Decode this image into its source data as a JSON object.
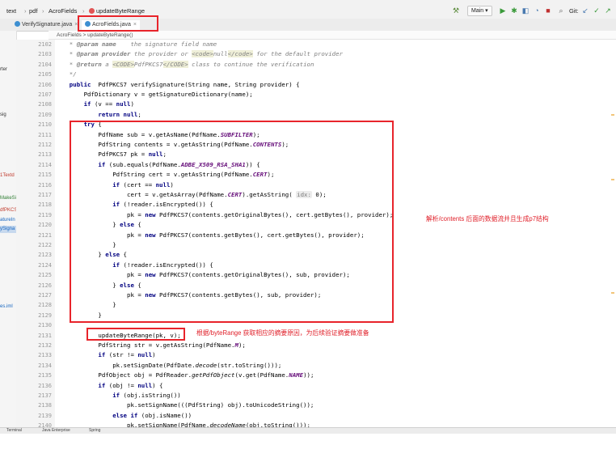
{
  "navbar": {
    "breadcrumbs": [
      "text",
      "pdf",
      "AcroFields",
      "updateByteRange"
    ],
    "branch": "Main",
    "git_label": "Git:"
  },
  "tabs": [
    {
      "label": "VerifySignature.java",
      "active": false
    },
    {
      "label": "AcroFields.java",
      "active": true
    }
  ],
  "editor_breadcrumb": "AcroFields  >  updateByteRange()",
  "sidebar": {
    "items": [
      "rter",
      "sig",
      "1Textd",
      "MakeSi",
      "dfPKCS",
      "atureIn",
      "ySigna",
      "es.iml"
    ]
  },
  "code": {
    "lines": [
      {
        "n": "2102",
        "segs": [
          [
            "cm",
            "    * "
          ],
          [
            "tg",
            "@param"
          ],
          [
            "cm",
            " "
          ],
          [
            "tg",
            "name"
          ],
          [
            "cm",
            "    the signature field name"
          ]
        ]
      },
      {
        "n": "2103",
        "segs": [
          [
            "cm",
            "    * "
          ],
          [
            "tg",
            "@param"
          ],
          [
            "cm",
            " "
          ],
          [
            "tg",
            "provider"
          ],
          [
            "cm",
            " the provider or "
          ],
          [
            "html",
            "<code>"
          ],
          [
            "cm",
            "null"
          ],
          [
            "html",
            "</code>"
          ],
          [
            "cm",
            " for the default provider"
          ]
        ]
      },
      {
        "n": "2104",
        "segs": [
          [
            "cm",
            "    * "
          ],
          [
            "tg",
            "@return"
          ],
          [
            "cm",
            " a "
          ],
          [
            "html",
            "<CODE>"
          ],
          [
            "cm",
            "PdfPKCS7"
          ],
          [
            "html",
            "</CODE>"
          ],
          [
            "cm",
            " class to continue the verification"
          ]
        ]
      },
      {
        "n": "2105",
        "segs": [
          [
            "cm",
            "    */"
          ]
        ]
      },
      {
        "n": "2106",
        "segs": [
          [
            "kw",
            "    public"
          ],
          [
            "",
            "  PdfPKCS7 verifySignature(String name, String provider) {"
          ]
        ]
      },
      {
        "n": "2107",
        "segs": [
          [
            "",
            "        PdfDictionary v = getSignatureDictionary(name);"
          ]
        ]
      },
      {
        "n": "2108",
        "segs": [
          [
            "kw",
            "        if"
          ],
          [
            "",
            " (v == "
          ],
          [
            "kw",
            "null"
          ],
          [
            "",
            ")"
          ]
        ]
      },
      {
        "n": "2109",
        "segs": [
          [
            "kw",
            "            return null"
          ],
          [
            "",
            ";"
          ]
        ]
      },
      {
        "n": "2110",
        "segs": [
          [
            "kw",
            "        try"
          ],
          [
            "",
            " {"
          ]
        ]
      },
      {
        "n": "2111",
        "segs": [
          [
            "",
            "            PdfName sub = v.getAsName(PdfName."
          ],
          [
            "fd",
            "SUBFILTER"
          ],
          [
            "",
            ");"
          ]
        ]
      },
      {
        "n": "2112",
        "segs": [
          [
            "",
            "            PdfString contents = v.getAsString(PdfName."
          ],
          [
            "fd",
            "CONTENTS"
          ],
          [
            "",
            ");"
          ]
        ]
      },
      {
        "n": "2113",
        "segs": [
          [
            "",
            "            PdfPKCS7 pk = "
          ],
          [
            "kw",
            "null"
          ],
          [
            "",
            ";"
          ]
        ]
      },
      {
        "n": "2114",
        "segs": [
          [
            "kw",
            "            if"
          ],
          [
            "",
            " (sub.equals(PdfName."
          ],
          [
            "fd",
            "ADBE_X509_RSA_SHA1"
          ],
          [
            "",
            ")) {"
          ]
        ]
      },
      {
        "n": "2115",
        "segs": [
          [
            "",
            "                PdfString cert = v.getAsString(PdfName."
          ],
          [
            "fd",
            "CERT"
          ],
          [
            "",
            ");"
          ]
        ]
      },
      {
        "n": "2116",
        "segs": [
          [
            "kw",
            "                if"
          ],
          [
            "",
            " (cert == "
          ],
          [
            "kw",
            "null"
          ],
          [
            "",
            ")"
          ]
        ]
      },
      {
        "n": "2117",
        "segs": [
          [
            "",
            "                    cert = v.getAsArray(PdfName."
          ],
          [
            "fd",
            "CERT"
          ],
          [
            "",
            ").getAsString( "
          ],
          [
            "hint",
            "idx:"
          ],
          [
            "",
            " 0);"
          ]
        ]
      },
      {
        "n": "2118",
        "segs": [
          [
            "kw",
            "                if"
          ],
          [
            "",
            " (!reader.isEncrypted()) {"
          ]
        ]
      },
      {
        "n": "2119",
        "segs": [
          [
            "",
            "                    pk = "
          ],
          [
            "kw",
            "new"
          ],
          [
            "",
            " PdfPKCS7(contents.getOriginalBytes(), cert.getBytes(), provider);"
          ]
        ]
      },
      {
        "n": "2120",
        "segs": [
          [
            "",
            "                } "
          ],
          [
            "kw",
            "else"
          ],
          [
            "",
            " {"
          ]
        ]
      },
      {
        "n": "2121",
        "segs": [
          [
            "",
            "                    pk = "
          ],
          [
            "kw",
            "new"
          ],
          [
            "",
            " PdfPKCS7(contents.getBytes(), cert.getBytes(), provider);"
          ]
        ]
      },
      {
        "n": "2122",
        "segs": [
          [
            "",
            "                }"
          ]
        ]
      },
      {
        "n": "2123",
        "segs": [
          [
            "",
            "            } "
          ],
          [
            "kw",
            "else"
          ],
          [
            "",
            " {"
          ]
        ]
      },
      {
        "n": "2124",
        "segs": [
          [
            "kw",
            "                if"
          ],
          [
            "",
            " (!reader.isEncrypted()) {"
          ]
        ]
      },
      {
        "n": "2125",
        "segs": [
          [
            "",
            "                    pk = "
          ],
          [
            "kw",
            "new"
          ],
          [
            "",
            " PdfPKCS7(contents.getOriginalBytes(), sub, provider);"
          ]
        ]
      },
      {
        "n": "2126",
        "segs": [
          [
            "",
            "                } "
          ],
          [
            "kw",
            "else"
          ],
          [
            "",
            " {"
          ]
        ]
      },
      {
        "n": "2127",
        "segs": [
          [
            "",
            "                    pk = "
          ],
          [
            "kw",
            "new"
          ],
          [
            "",
            " PdfPKCS7(contents.getBytes(), sub, provider);"
          ]
        ]
      },
      {
        "n": "2128",
        "segs": [
          [
            "",
            "                }"
          ]
        ]
      },
      {
        "n": "2129",
        "segs": [
          [
            "",
            "            }"
          ]
        ]
      },
      {
        "n": "2130",
        "segs": [
          [
            "",
            " "
          ]
        ]
      },
      {
        "n": "2131",
        "segs": [
          [
            "",
            "            updateByteRange(pk, v);"
          ]
        ]
      },
      {
        "n": "2132",
        "segs": [
          [
            "",
            "            PdfString str = v.getAsString(PdfName."
          ],
          [
            "fd",
            "M"
          ],
          [
            "",
            ");"
          ]
        ]
      },
      {
        "n": "2133",
        "segs": [
          [
            "kw",
            "            if"
          ],
          [
            "",
            " (str != "
          ],
          [
            "kw",
            "null"
          ],
          [
            "",
            ")"
          ]
        ]
      },
      {
        "n": "2134",
        "segs": [
          [
            "",
            "                pk.setSignDate(PdfDate."
          ],
          [
            "st",
            "decode"
          ],
          [
            "",
            "(str.toString()));"
          ]
        ]
      },
      {
        "n": "2135",
        "segs": [
          [
            "",
            "            PdfObject obj = PdfReader."
          ],
          [
            "st",
            "getPdfObject"
          ],
          [
            "",
            "(v.get(PdfName."
          ],
          [
            "fd",
            "NAME"
          ],
          [
            "",
            "));"
          ]
        ]
      },
      {
        "n": "2136",
        "segs": [
          [
            "kw",
            "            if"
          ],
          [
            "",
            " (obj != "
          ],
          [
            "kw",
            "null"
          ],
          [
            "",
            ") {"
          ]
        ]
      },
      {
        "n": "2137",
        "segs": [
          [
            "kw",
            "                if"
          ],
          [
            "",
            " (obj.isString())"
          ]
        ]
      },
      {
        "n": "2138",
        "segs": [
          [
            "",
            "                    pk.setSignName(((PdfString) obj).toUnicodeString());"
          ]
        ]
      },
      {
        "n": "2139",
        "segs": [
          [
            "kw",
            "                else if"
          ],
          [
            "",
            " (obj.isName())"
          ]
        ]
      },
      {
        "n": "2140",
        "segs": [
          [
            "",
            "                    pk.setSignName(PdfName."
          ],
          [
            "st",
            "decodeName"
          ],
          [
            "",
            "(obj.toString()));"
          ]
        ]
      }
    ]
  },
  "annotations": {
    "contents_note": "解析/contents 后面的数据流并且生成p7结构",
    "byterange_note": "根据/byteRange 获取相应的摘要原因，为后续验证摘要做准备"
  },
  "statusbar": {
    "items": [
      "Terminal",
      "Java Enterprise",
      "Spring"
    ]
  },
  "colors": {
    "annotation_red": "#e8242b",
    "keyword": "#000080",
    "field": "#660e7a"
  }
}
